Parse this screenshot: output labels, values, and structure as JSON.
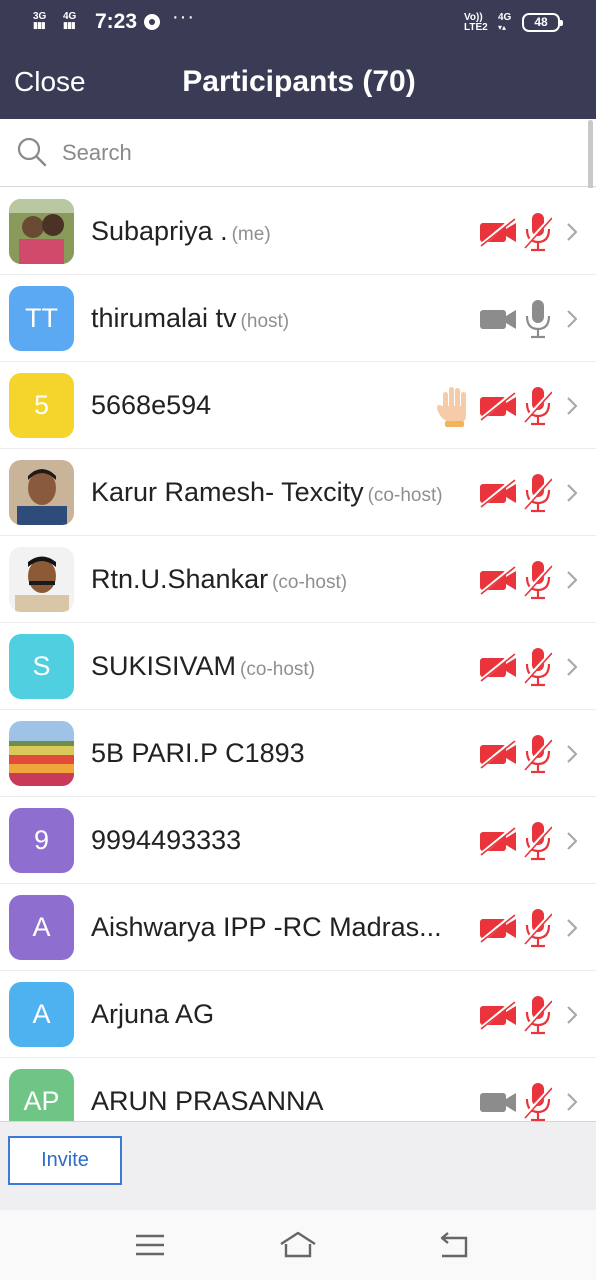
{
  "status_bar": {
    "sim1": "3G",
    "sim2": "4G",
    "time": "7:23",
    "more": "···",
    "volte_top": "Vo))",
    "volte_bottom": "LTE2",
    "net": "4G",
    "battery": "48"
  },
  "header": {
    "close_label": "Close",
    "title": "Participants (70)"
  },
  "search": {
    "placeholder": "Search"
  },
  "participants": [
    {
      "name": "Subapriya .",
      "role": "(me)",
      "avatar": "photo",
      "video": "off",
      "mic": "off",
      "hand_raised": false
    },
    {
      "name": "thirumalai tv",
      "role": "(host)",
      "avatar": "TT",
      "avatar_color": "#5aa9f2",
      "video": "on",
      "mic": "on",
      "hand_raised": false
    },
    {
      "name": "5668e594",
      "role": "",
      "avatar": "5",
      "avatar_color": "#f5d42b",
      "video": "off",
      "mic": "off",
      "hand_raised": true
    },
    {
      "name": "Karur Ramesh- Texcity",
      "role": "(co-host)",
      "avatar": "photo",
      "video": "off",
      "mic": "off",
      "hand_raised": false
    },
    {
      "name": "Rtn.U.Shankar",
      "role": "(co-host)",
      "avatar": "photo",
      "video": "off",
      "mic": "off",
      "hand_raised": false
    },
    {
      "name": "SUKISIVAM",
      "role": "(co-host)",
      "avatar": "S",
      "avatar_color": "#4fcfe0",
      "video": "off",
      "mic": "off",
      "hand_raised": false
    },
    {
      "name": "5B PARI.P C1893",
      "role": "",
      "avatar": "photo",
      "video": "off",
      "mic": "off",
      "hand_raised": false
    },
    {
      "name": "9994493333",
      "role": "",
      "avatar": "9",
      "avatar_color": "#8e6fd0",
      "video": "off",
      "mic": "off",
      "hand_raised": false
    },
    {
      "name": "Aishwarya  IPP -RC Madras...",
      "role": "",
      "avatar": "A",
      "avatar_color": "#8e6fd0",
      "video": "off",
      "mic": "off",
      "hand_raised": false
    },
    {
      "name": "Arjuna  AG",
      "role": "",
      "avatar": "A",
      "avatar_color": "#4fb2f0",
      "video": "off",
      "mic": "off",
      "hand_raised": false
    },
    {
      "name": "ARUN PRASANNA",
      "role": "",
      "avatar": "AP",
      "avatar_color": "#6fc586",
      "video": "on",
      "mic": "off",
      "hand_raised": false
    }
  ],
  "footer": {
    "invite_label": "Invite"
  },
  "colors": {
    "header_bg": "#3a3c56",
    "muted_red": "#e8343a",
    "active_gray": "#8c8c8c",
    "invite_blue": "#2f6cc7"
  },
  "icons": [
    "search-icon",
    "video-off-icon",
    "video-on-icon",
    "mic-off-icon",
    "mic-on-icon",
    "raised-hand-icon",
    "chevron-right-icon",
    "menu-icon",
    "home-icon",
    "back-icon"
  ]
}
